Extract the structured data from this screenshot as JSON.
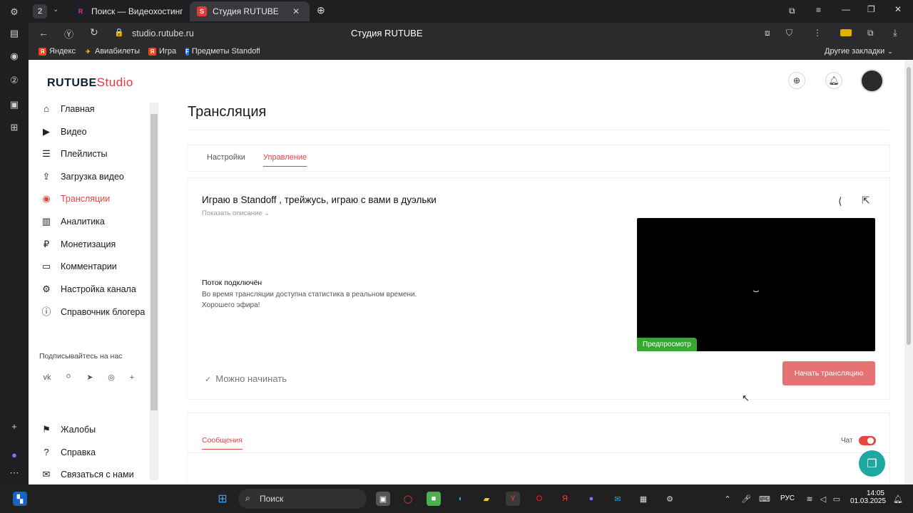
{
  "browser": {
    "tabs": [
      {
        "label": "Поиск — Видеохостинг R",
        "favicon": "R"
      },
      {
        "label": "Студия RUTUBE",
        "favicon": "S"
      }
    ],
    "tab_counter": "2",
    "url": "studio.rutube.ru",
    "page_title": "Студия RUTUBE",
    "bookmarks": [
      {
        "label": "Яндекс",
        "icon": "Я"
      },
      {
        "label": "Авиабилеты",
        "icon": "✈"
      },
      {
        "label": "Игра",
        "icon": "Я"
      },
      {
        "label": "Предметы Standoff",
        "icon": "F"
      }
    ],
    "other_bookmarks": "Другие закладки"
  },
  "sidebar": {
    "logo_main": "RUTUBE",
    "logo_studio": "Studio",
    "items": [
      {
        "label": "Главная",
        "icon": "home-icon"
      },
      {
        "label": "Видео",
        "icon": "video-icon"
      },
      {
        "label": "Плейлисты",
        "icon": "playlist-icon"
      },
      {
        "label": "Загрузка видео",
        "icon": "upload-icon"
      },
      {
        "label": "Трансляции",
        "icon": "broadcast-icon"
      },
      {
        "label": "Аналитика",
        "icon": "analytics-icon"
      },
      {
        "label": "Монетизация",
        "icon": "ruble-icon"
      },
      {
        "label": "Комментарии",
        "icon": "comment-icon"
      },
      {
        "label": "Настройка канала",
        "icon": "gear-icon"
      },
      {
        "label": "Справочник блогера",
        "icon": "info-icon"
      }
    ],
    "subscribe_label": "Подписывайтесь на нас",
    "bottom_items": [
      {
        "label": "Жалобы",
        "icon": "flag-icon"
      },
      {
        "label": "Справка",
        "icon": "help-icon"
      },
      {
        "label": "Связаться с нами",
        "icon": "mail-icon"
      }
    ]
  },
  "main": {
    "title": "Трансляция",
    "tabs": [
      {
        "label": "Настройки"
      },
      {
        "label": "Управление"
      }
    ],
    "stream": {
      "title": "Играю в Standoff , трейжусь, играю с вами в дуэльки",
      "show_description": "Показать описание",
      "status_title": "Поток подключён",
      "status_text_1": "Во время трансляции доступна статистика в реальном времени.",
      "status_text_2": "Хорошего эфира!",
      "preview_badge": "Предпросмотр",
      "ready_label": "Можно начинать",
      "start_button": "Начать трансляцию"
    },
    "chat": {
      "tab_label": "Сообщения",
      "toggle_label": "Чат",
      "toggle_on": true
    }
  },
  "taskbar": {
    "search_label": "Поиск",
    "lang": "РУС",
    "time": "14:05",
    "date": "01.03.2025"
  },
  "colors": {
    "accent": "#e4473f",
    "button": "#e57373",
    "preview_badge": "#36a832"
  }
}
